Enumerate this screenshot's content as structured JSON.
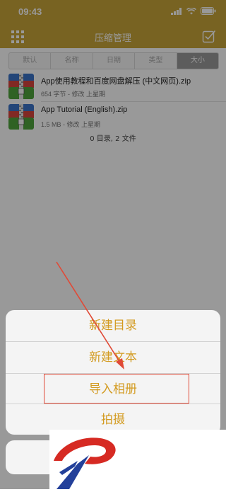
{
  "status_bar": {
    "time": "09:43"
  },
  "nav": {
    "title": "压缩管理"
  },
  "sort_tabs": [
    "默认",
    "名称",
    "日期",
    "类型",
    "大小"
  ],
  "files": [
    {
      "name": "App使用教程和百度网盘解压 (中文网页).zip",
      "meta": "654 字节 - 修改 上星期"
    },
    {
      "name": "App Tutorial (English).zip",
      "meta": "1.5 MB - 修改 上星期"
    }
  ],
  "summary": "0 目录, 2 文件",
  "action_sheet": {
    "items": [
      "新建目录",
      "新建文本",
      "导入相册",
      "拍摄"
    ]
  },
  "colors": {
    "brand_gold": "#c9a53a",
    "action_text": "#d39b21",
    "annotation_red": "#e04a37"
  }
}
